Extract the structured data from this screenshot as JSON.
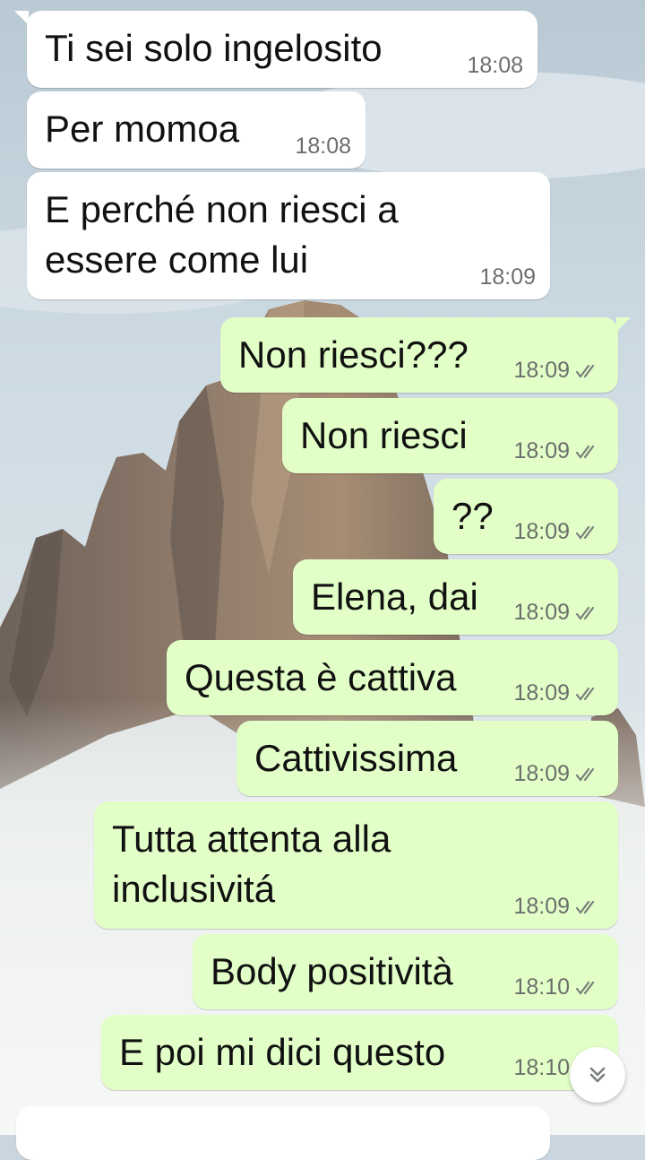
{
  "messages": [
    {
      "text": "Ti sei solo ingelosito",
      "time": "18:08",
      "direction": "in"
    },
    {
      "text": "Per momoa",
      "time": "18:08",
      "direction": "in"
    },
    {
      "text": "E perché non riesci a\nessere come lui",
      "time": "18:09",
      "direction": "in"
    },
    {
      "text": "Non riesci???",
      "time": "18:09",
      "direction": "out",
      "status": "read"
    },
    {
      "text": "Non riesci",
      "time": "18:09",
      "direction": "out",
      "status": "read"
    },
    {
      "text": "??",
      "time": "18:09",
      "direction": "out",
      "status": "read"
    },
    {
      "text": "Elena, dai",
      "time": "18:09",
      "direction": "out",
      "status": "read"
    },
    {
      "text": "Questa è cattiva",
      "time": "18:09",
      "direction": "out",
      "status": "read"
    },
    {
      "text": "Cattivissima",
      "time": "18:09",
      "direction": "out",
      "status": "read"
    },
    {
      "text": "Tutta attenta alla\ninclusivitá",
      "time": "18:09",
      "direction": "out",
      "status": "read"
    },
    {
      "text": "Body positività",
      "time": "18:10",
      "direction": "out",
      "status": "read"
    },
    {
      "text": "E poi mi dici questo",
      "time": "18:10",
      "direction": "out",
      "status": "read"
    }
  ],
  "icons": {
    "read_receipt": "double-check-icon",
    "scroll_down": "double-chevron-down-icon"
  },
  "colors": {
    "incoming_bubble": "#ffffff",
    "outgoing_bubble": "#e2ffc7",
    "timestamp": "#6b6f6c",
    "tick": "#7a7f7b"
  }
}
